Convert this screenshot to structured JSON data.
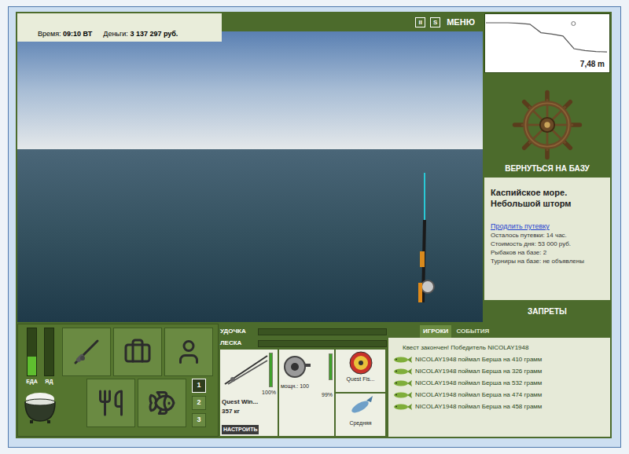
{
  "status": {
    "time_label": "Время:",
    "time": "09:10 ВТ",
    "money_label": "Деньги:",
    "money": "3 137 297 руб."
  },
  "top_buttons": [
    "II",
    "S",
    "МЕНЮ"
  ],
  "depth": {
    "reading": "7,48 m",
    "profile": [
      0.5,
      0.5,
      0.5,
      0.6,
      0.8,
      2.6,
      2.9,
      3.3,
      6.0,
      6.4,
      6.6,
      6.7
    ],
    "float_position": 0.72
  },
  "base_button": "ВЕРНУТЬСЯ НА БАЗУ",
  "location": {
    "title": "Каспийское море.",
    "weather": "Небольшой шторм",
    "extend_link": "Продлить путевку",
    "details": [
      "Осталось путевки: 14 час.",
      "Стоимость дня: 53 000 руб.",
      "Рыбаков на базе: 2",
      "Турниры на базе: не объявлены"
    ]
  },
  "bans_button": "ЗАПРЕТЫ",
  "needs": [
    {
      "label": "ЕДА",
      "level": 0.4
    },
    {
      "label": "ЯД",
      "level": 0
    }
  ],
  "slots": [
    {
      "label": "1",
      "selected": true
    },
    {
      "label": "2",
      "selected": false
    },
    {
      "label": "3",
      "selected": false
    }
  ],
  "tension": [
    {
      "label": "УДОЧКА",
      "level": 0
    },
    {
      "label": "ЛЕСКА",
      "level": 0
    }
  ],
  "rod": {
    "name": "Quest Win...",
    "capacity": "357 кг",
    "condition": "100%",
    "level": 1,
    "setup_button": "НАСТРОИТЬ"
  },
  "reel": {
    "power": "мощн.: 100",
    "condition": "99%",
    "level": 0.99
  },
  "line": {
    "name": "Quest Fis..."
  },
  "lure": {
    "size": "Средняя"
  },
  "tabs": [
    {
      "label": "ИГРОКИ",
      "selected": true
    },
    {
      "label": "СОБЫТИЯ",
      "selected": false
    }
  ],
  "events": [
    {
      "kind": "quest",
      "text": "Квест закончен! Победитель NICOLAY1948"
    },
    {
      "kind": "catch",
      "text": "NICOLAY1948 поймал Берша на 410 грамм"
    },
    {
      "kind": "catch",
      "text": "NICOLAY1948 поймал Берша на 326 грамм"
    },
    {
      "kind": "catch",
      "text": "NICOLAY1948 поймал Берша на 532 грамм"
    },
    {
      "kind": "catch",
      "text": "NICOLAY1948 поймал Берша на 474 грамм"
    },
    {
      "kind": "catch",
      "text": "NICOLAY1948 поймал Берша на 458 грамм"
    }
  ]
}
